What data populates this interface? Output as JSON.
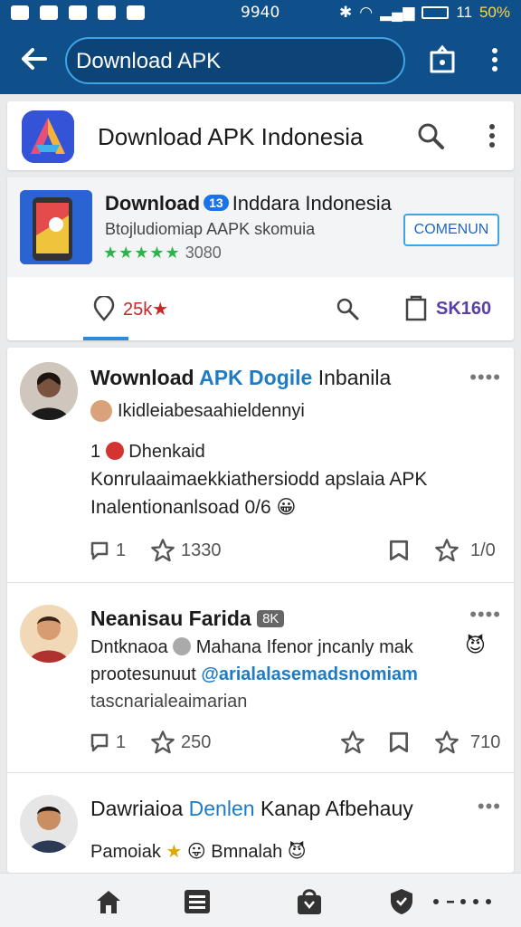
{
  "status": {
    "time": "9940",
    "clock": "11",
    "battery_pct": "50%"
  },
  "appbar": {
    "search_value": "Download APK"
  },
  "header": {
    "title": "Download APK Indonesia"
  },
  "promo": {
    "title_bold": "Download",
    "badge": "13",
    "title_rest": "Inddara Indonesia",
    "subtitle": "Btojludiomiap AAPK skomuia",
    "stars": "★★★★★",
    "rating_count": "3080",
    "button_label": "COMENUN"
  },
  "tabs": [
    {
      "label": "25k",
      "mark": "★"
    },
    {
      "label": ""
    },
    {
      "label": "SK160"
    }
  ],
  "posts": [
    {
      "author_a": "Wownload",
      "author_hl": "APK Dogile",
      "author_c": "Inbanila",
      "more": "••••",
      "handle": "Ikidleiabesaahieldennyi",
      "line2_num": "1",
      "line2_text": "Dhenkaid",
      "body1": "Konrulaaimaekkiathersiodd apslaia APK",
      "body2": "Inalentionanlsoad 0/6",
      "emoji": "😀",
      "comments": "1",
      "stars": "1330",
      "shares": "1/0"
    },
    {
      "author": "Neanisau Farida",
      "tag": "8K",
      "more": "••••",
      "line1": "Dntknaoa",
      "line1b": "Mahana Ifenor jncanly mak",
      "line2a": "prootesunuut",
      "mention": "@arialalasemadsnomiam",
      "line3": "tascnarialeaimarian",
      "comments": "1",
      "stars": "250",
      "likes": "710"
    },
    {
      "author_a": "Dawriaioa",
      "author_hl": "Denlen",
      "author_c": "Kanap Afbehauy",
      "more": "•••",
      "line1": "Pamoiak",
      "line1b": "Bmnalah"
    }
  ],
  "colors": {
    "appbar": "#0f4f8a",
    "accent": "#1f7cc4",
    "star_green": "#2db34a"
  }
}
